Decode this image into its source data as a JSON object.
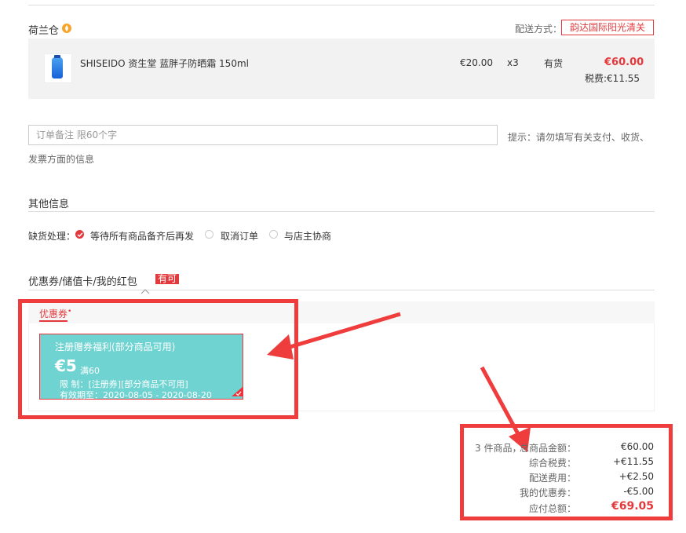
{
  "warehouse": {
    "name": "荷兰仓"
  },
  "delivery": {
    "label": "配送方式：",
    "method": "韵达国际阳光清关"
  },
  "product": {
    "name": "SHISEIDO 资生堂 蓝胖子防晒霜 150ml",
    "unit_price": "€20.00",
    "quantity": "x3",
    "stock": "有货",
    "total": "€60.00",
    "tax": "税费:€11.55"
  },
  "remark": {
    "placeholder": "订单备注 限60个字",
    "hint_line1": "提示：请勿填写有关支付、收货、",
    "hint_line2": "发票方面的信息"
  },
  "other_info": {
    "title": "其他信息",
    "shortage_label": "缺货处理：",
    "options": [
      "等待所有商品备齐后再发",
      "取消订单",
      "与店主协商"
    ],
    "selected": 0
  },
  "discounts": {
    "title": "优惠券/储值卡/我的红包",
    "badge": "有可",
    "tab_label": "优惠券"
  },
  "coupon": {
    "title": "注册赠券福利(部分商品可用)",
    "amount": "€5",
    "threshold": "满60",
    "limit": "限 制：[注册券][部分商品不可用]",
    "validity": "有效期至：2020-08-05 - 2020-08-20"
  },
  "summary": {
    "count_text": "3 件商品，",
    "rows": [
      {
        "label": "总商品金额：",
        "value": "€60.00"
      },
      {
        "label": "综合税费：",
        "value": "+€11.55"
      },
      {
        "label": "配送费用：",
        "value": "+€2.50"
      },
      {
        "label": "我的优惠券：",
        "value": "-€5.00"
      },
      {
        "label": "应付总额：",
        "value": "€69.05"
      }
    ]
  },
  "colors": {
    "accent": "#e4393c",
    "coupon": "#6fd3d1",
    "highlight": "#ef3c3c"
  }
}
